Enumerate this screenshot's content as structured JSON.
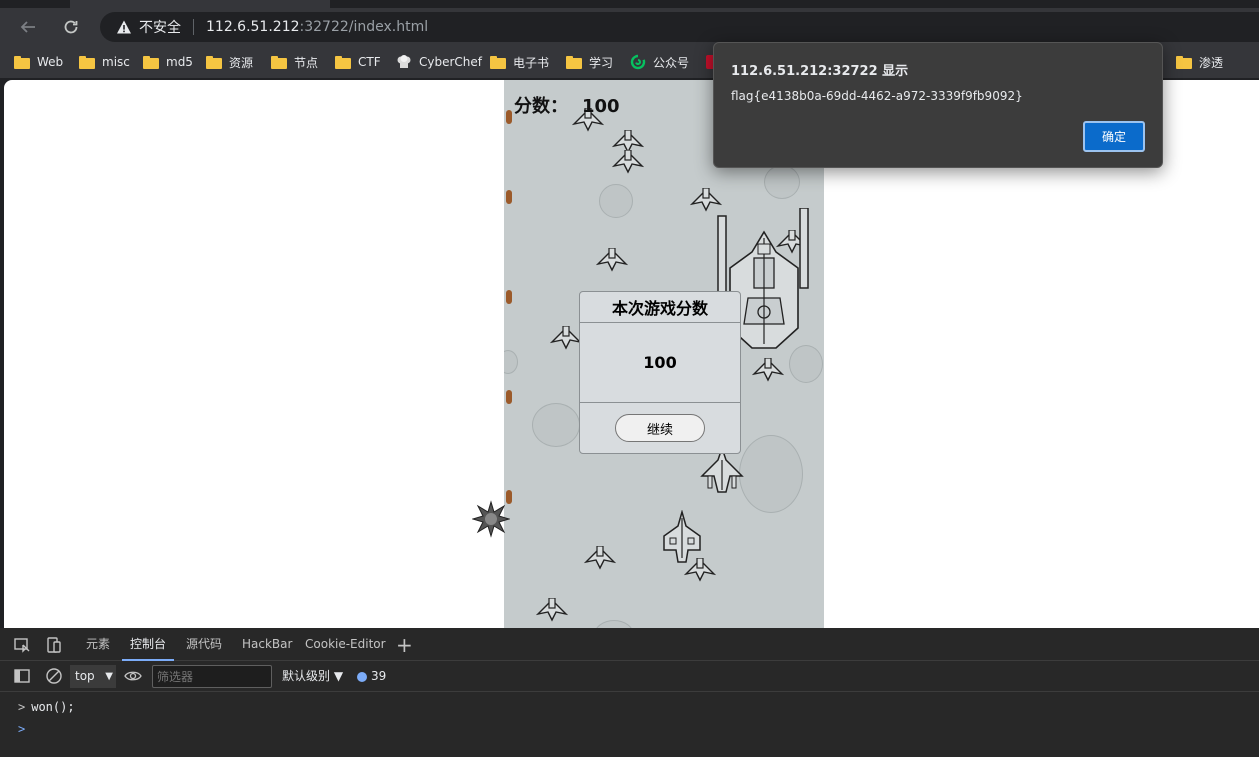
{
  "browser": {
    "address": {
      "security_label": "不安全",
      "url_host": "112.6.51.212",
      "url_rest": ":32722/index.html"
    },
    "bookmarks": [
      {
        "label": "Web",
        "icon": "folder-icon"
      },
      {
        "label": "misc",
        "icon": "folder-icon"
      },
      {
        "label": "md5",
        "icon": "folder-icon"
      },
      {
        "label": "资源",
        "icon": "folder-icon"
      },
      {
        "label": "节点",
        "icon": "folder-icon"
      },
      {
        "label": "CTF",
        "icon": "folder-icon"
      },
      {
        "label": "CyberChef",
        "icon": "chef-hat-icon"
      },
      {
        "label": "电子书",
        "icon": "folder-icon"
      },
      {
        "label": "学习",
        "icon": "folder-icon"
      },
      {
        "label": "公众号",
        "icon": "wechat-icon"
      },
      {
        "label": "渗透",
        "icon": "folder-icon"
      }
    ]
  },
  "game": {
    "score_label": "分数：",
    "score_value": "100",
    "dialog": {
      "title": "本次游戏分数",
      "value": "100",
      "button_label": "继续"
    }
  },
  "alert": {
    "title": "112.6.51.212:32722 显示",
    "message": "flag{e4138b0a-69dd-4462-a972-3339f9fb9092}",
    "ok_label": "确定"
  },
  "devtools": {
    "tabs": [
      "元素",
      "控制台",
      "源代码",
      "HackBar",
      "Cookie-Editor"
    ],
    "active_tab": "控制台",
    "context": "top",
    "filter_placeholder": "筛选器",
    "level": "默认级别",
    "message_count": "39",
    "console_input": "won();"
  },
  "colors": {
    "accent": "#0b6bcb",
    "game_background": "#c5cbcc",
    "devtools_background": "#282828"
  }
}
